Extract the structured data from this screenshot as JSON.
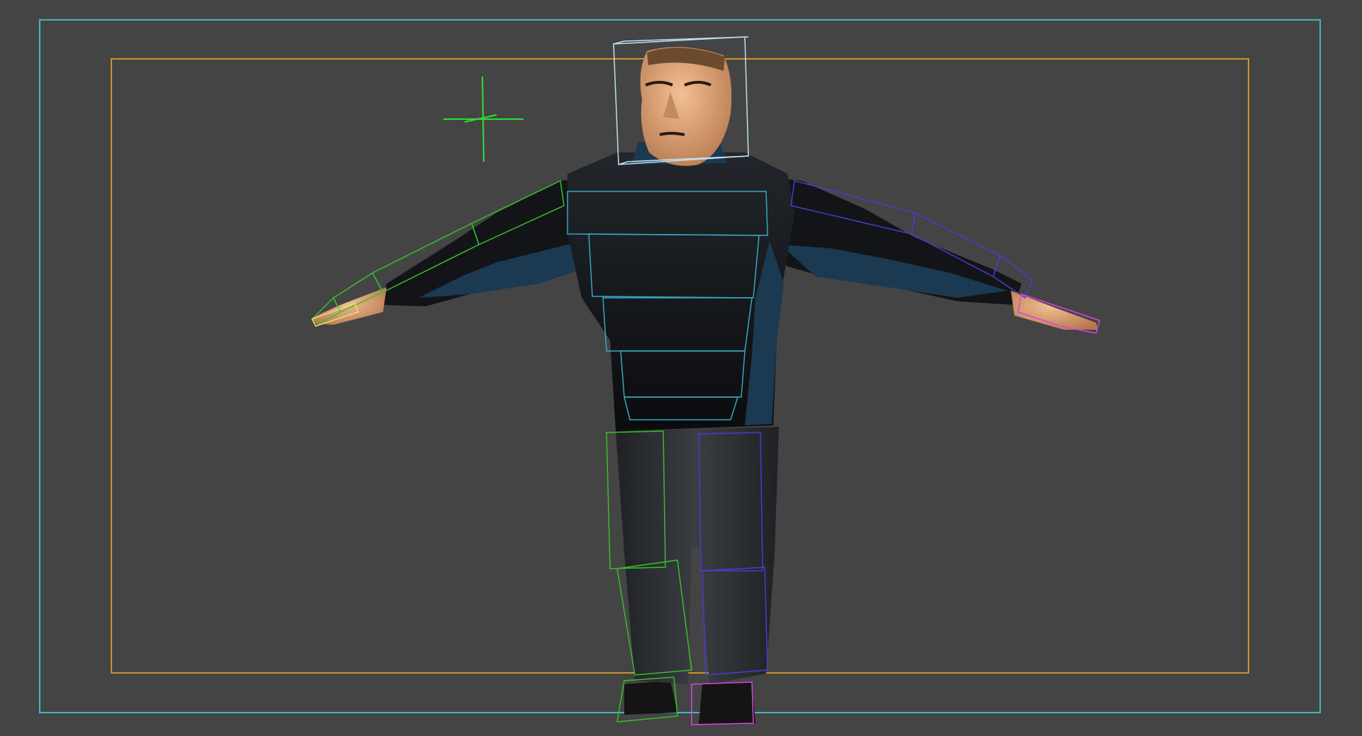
{
  "viewport": {
    "background": "#444444",
    "safe_frame_outer_color": "#3fb8c4",
    "safe_frame_inner_color": "#c9942a",
    "light_gizmo_color": "#2ee02e"
  },
  "character": {
    "skin_color": "#e0a878",
    "shirt_color": "#141619",
    "shirt_accent_color": "#1b3a52",
    "pants_color": "#2a2c30",
    "shoes_color": "#141414"
  },
  "rig": {
    "head_box_color": "#bfe0f0",
    "spine_box_color": "#37a7c3",
    "left_limb_color": "#3bbd2b",
    "right_limb_color": "#4b3bd0",
    "right_hand_color": "#e040e0",
    "left_hand_color": "#e8e070"
  }
}
